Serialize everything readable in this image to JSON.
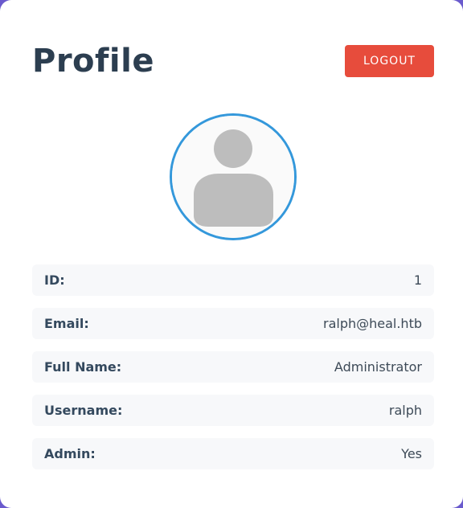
{
  "header": {
    "title": "Profile",
    "logout_label": "LOGOUT"
  },
  "avatar": {
    "icon": "user-silhouette-icon",
    "border_color": "#3498db"
  },
  "fields": [
    {
      "label": "ID:",
      "value": "1"
    },
    {
      "label": "Email:",
      "value": "ralph@heal.htb"
    },
    {
      "label": "Full Name:",
      "value": "Administrator"
    },
    {
      "label": "Username:",
      "value": "ralph"
    },
    {
      "label": "Admin:",
      "value": "Yes"
    }
  ],
  "colors": {
    "accent": "#3498db",
    "danger": "#e74c3c",
    "text": "#2c3e50",
    "background": "#6a5acd"
  }
}
